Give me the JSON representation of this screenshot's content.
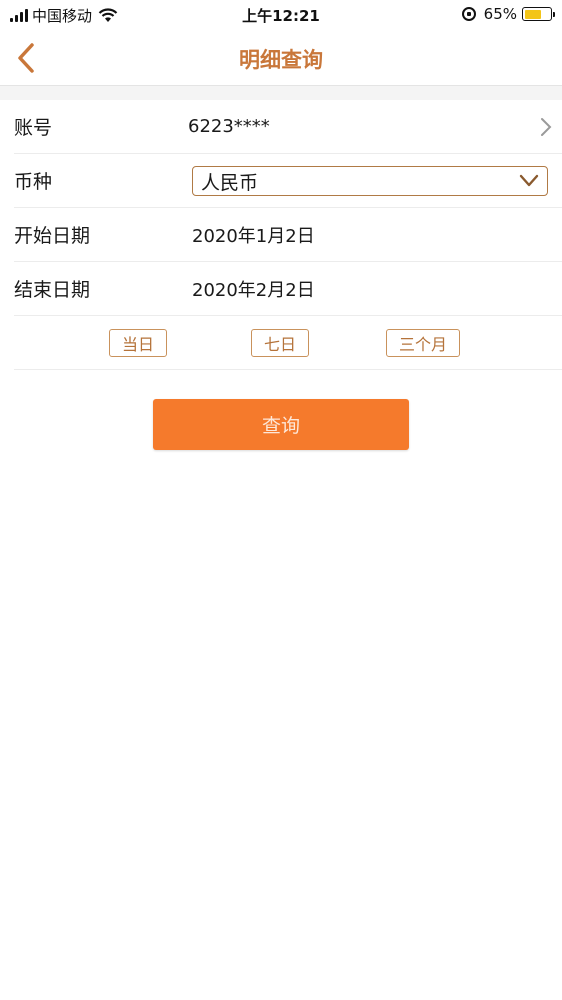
{
  "status_bar": {
    "carrier": "中国移动",
    "time": "上午12:21",
    "battery_percent": "65%",
    "battery_level": 0.65,
    "battery_color": "#f3c518"
  },
  "nav": {
    "title": "明细查询",
    "back_icon": "chevron-left-icon",
    "accent_color": "#c9773a"
  },
  "form": {
    "account": {
      "label": "账号",
      "value": "6223****"
    },
    "currency": {
      "label": "币种",
      "value": "人民币"
    },
    "start_date": {
      "label": "开始日期",
      "value": "2020年1月2日"
    },
    "end_date": {
      "label": "结束日期",
      "value": "2020年2月2日"
    }
  },
  "quick_ranges": [
    "当日",
    "七日",
    "三个月"
  ],
  "query_button": {
    "label": "查询",
    "color": "#f57a2c"
  }
}
